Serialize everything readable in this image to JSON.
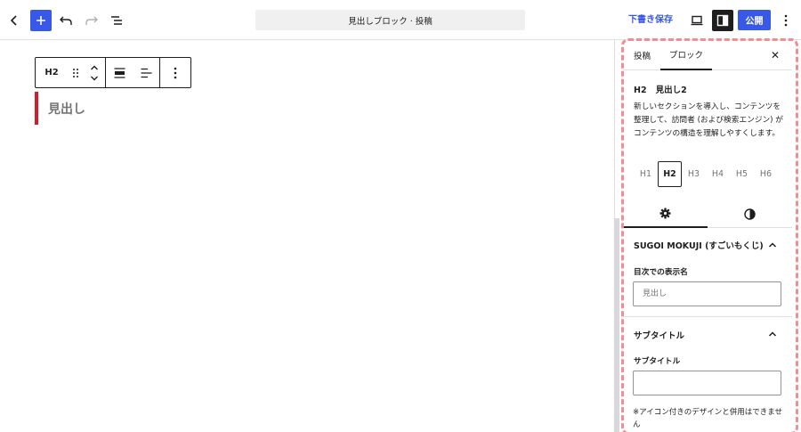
{
  "topbar": {
    "title": "見出しブロック · 投稿",
    "save_draft_label": "下書き保存",
    "publish_label": "公開",
    "icons": [
      "chevron-left-icon",
      "plus-icon",
      "undo-icon",
      "redo-icon",
      "list-view-icon",
      "desktop-preview-icon",
      "sidebar-icon",
      "more-vertical-icon"
    ],
    "accent_color": "#3858e9"
  },
  "block_toolbar": {
    "type_label": "H2"
  },
  "editor": {
    "heading_text": "見出し",
    "heading_accent_color": "#d31d2a"
  },
  "sidebar": {
    "tabs": [
      {
        "label": "投稿",
        "active": false
      },
      {
        "label": "ブロック",
        "active": true
      }
    ],
    "close_label": "✕",
    "block_card": {
      "tag": "H2",
      "name": "見出し2",
      "description": "新しいセクションを導入し、コンテンツを整理して、訪問者 (および検索エンジン) がコンテンツの構造を理解しやすくします。"
    },
    "levels": [
      "H1",
      "H2",
      "H3",
      "H4",
      "H5",
      "H6"
    ],
    "active_level": "H2",
    "panels": {
      "sugoi": {
        "title": "SUGOI MOKUJI (すごいもくじ)",
        "field_label": "目次での表示名",
        "field_placeholder": "見出し"
      },
      "subtitle": {
        "title": "サブタイトル",
        "field_label": "サブタイトル",
        "field_value": "",
        "note": "※アイコン付きのデザインと併用はできません"
      }
    },
    "highlight_color": "#f08e92"
  }
}
